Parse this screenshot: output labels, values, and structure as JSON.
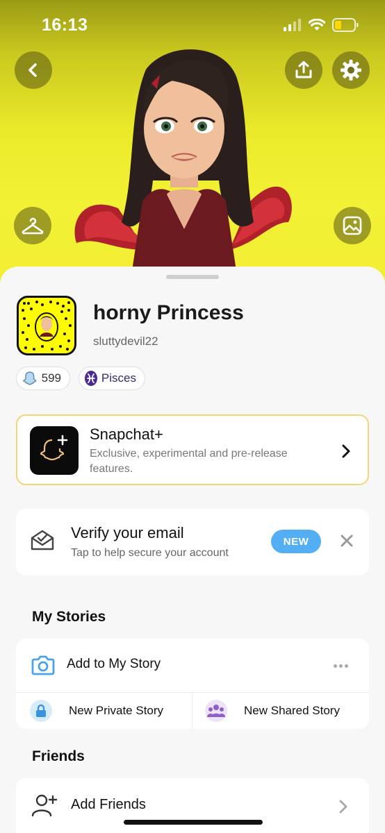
{
  "status_bar": {
    "time": "16:13"
  },
  "profile": {
    "display_name": "horny Princess",
    "username": "sluttydevil22",
    "snap_score": "599",
    "zodiac": "Pisces"
  },
  "snapchat_plus": {
    "title": "Snapchat+",
    "description": "Exclusive, experimental and pre-release features."
  },
  "verify_email": {
    "title": "Verify your email",
    "subtitle": "Tap to help secure your account",
    "badge": "NEW"
  },
  "my_stories": {
    "section_title": "My Stories",
    "add_label": "Add to My Story",
    "private_label": "New Private Story",
    "shared_label": "New Shared Story"
  },
  "friends": {
    "section_title": "Friends",
    "add_label": "Add Friends"
  },
  "colors": {
    "snap_yellow": "#fffc00",
    "header_yellow": "#f1ee33",
    "badge_blue": "#53aef3",
    "plus_gold": "#f0d57a",
    "zodiac_purple": "#4a2a8c"
  },
  "icons": {
    "back": "chevron-left-icon",
    "share": "share-icon",
    "settings": "gear-icon",
    "outfit": "hanger-icon",
    "background": "image-icon",
    "camera": "camera-icon",
    "lock": "lock-icon",
    "group": "group-icon",
    "add_friend": "add-friend-icon"
  }
}
